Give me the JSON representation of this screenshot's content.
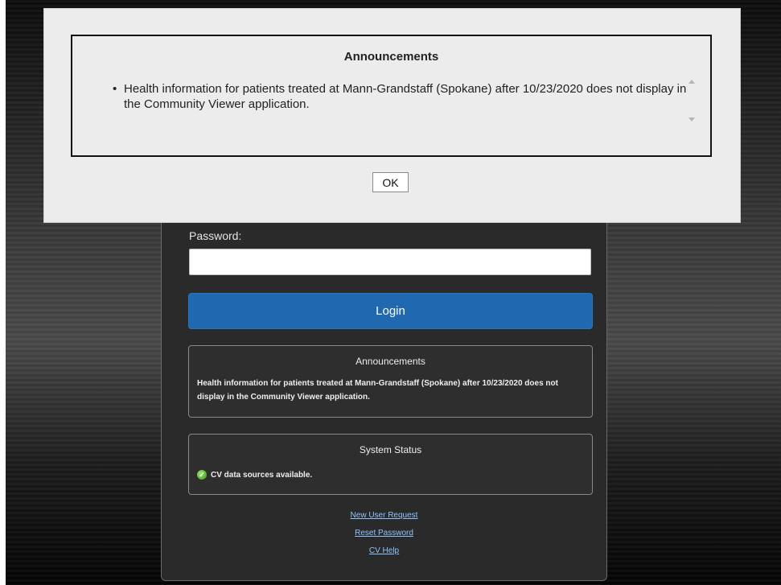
{
  "login": {
    "password_label": "Password:",
    "password_value": "",
    "login_button": "Login"
  },
  "announcements_box": {
    "title": "Announcements",
    "text": "Health information for patients treated at Mann-Grandstaff (Spokane) after 10/23/2020 does not display in the Community Viewer application."
  },
  "system_status": {
    "title": "System Status",
    "icon": "check-circle-icon",
    "text": "CV data sources available."
  },
  "links": [
    {
      "label": "New User Request"
    },
    {
      "label": "Reset Password"
    },
    {
      "label": "CV Help"
    }
  ],
  "modal": {
    "title": "Announcements",
    "items": [
      "Health information for patients treated at Mann-Grandstaff (Spokane) after 10/23/2020 does not display in the Community Viewer application."
    ],
    "ok_label": "OK"
  },
  "colors": {
    "login_button": "#2068b0",
    "link": "#8fc3ff",
    "modal_background": "#ececec",
    "status_ok": "#3a9a1c"
  }
}
